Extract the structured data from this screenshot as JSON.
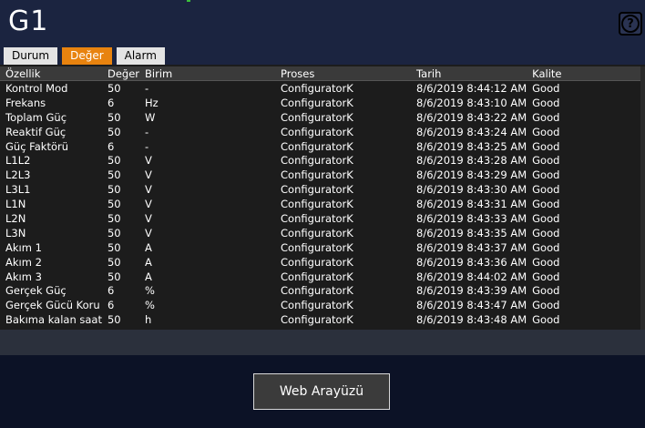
{
  "window": {
    "title": "G1"
  },
  "help": {
    "glyph": "?"
  },
  "tabs": [
    {
      "label": "Durum",
      "active": false
    },
    {
      "label": "Değer",
      "active": true
    },
    {
      "label": "Alarm",
      "active": false
    }
  ],
  "table": {
    "headers": [
      "Özellik",
      "Değer",
      "Birim",
      "Proses",
      "Tarih",
      "Kalite"
    ],
    "rows": [
      [
        "Kontrol Mod",
        "50",
        "-",
        "ConfiguratorK",
        "8/6/2019 8:44:12 AM",
        "Good"
      ],
      [
        "Frekans",
        "6",
        "Hz",
        "ConfiguratorK",
        "8/6/2019 8:43:10 AM",
        "Good"
      ],
      [
        "Toplam Güç",
        "50",
        "W",
        "ConfiguratorK",
        "8/6/2019 8:43:22 AM",
        "Good"
      ],
      [
        "Reaktif Güç",
        "50",
        "-",
        "ConfiguratorK",
        "8/6/2019 8:43:24 AM",
        "Good"
      ],
      [
        "Güç Faktörü",
        "6",
        "-",
        "ConfiguratorK",
        "8/6/2019 8:43:25 AM",
        "Good"
      ],
      [
        "L1L2",
        "50",
        "V",
        "ConfiguratorK",
        "8/6/2019 8:43:28 AM",
        "Good"
      ],
      [
        "L2L3",
        "50",
        "V",
        "ConfiguratorK",
        "8/6/2019 8:43:29 AM",
        "Good"
      ],
      [
        "L3L1",
        "50",
        "V",
        "ConfiguratorK",
        "8/6/2019 8:43:30 AM",
        "Good"
      ],
      [
        "L1N",
        "50",
        "V",
        "ConfiguratorK",
        "8/6/2019 8:43:31 AM",
        "Good"
      ],
      [
        "L2N",
        "50",
        "V",
        "ConfiguratorK",
        "8/6/2019 8:43:33 AM",
        "Good"
      ],
      [
        "L3N",
        "50",
        "V",
        "ConfiguratorK",
        "8/6/2019 8:43:35 AM",
        "Good"
      ],
      [
        "Akım 1",
        "50",
        "A",
        "ConfiguratorK",
        "8/6/2019 8:43:37 AM",
        "Good"
      ],
      [
        "Akım 2",
        "50",
        "A",
        "ConfiguratorK",
        "8/6/2019 8:43:36 AM",
        "Good"
      ],
      [
        "Akım 3",
        "50",
        "A",
        "ConfiguratorK",
        "8/6/2019 8:44:02 AM",
        "Good"
      ],
      [
        "Gerçek Güç",
        "6",
        "%",
        "ConfiguratorK",
        "8/6/2019 8:43:39 AM",
        "Good"
      ],
      [
        "Gerçek Gücü Koru",
        "6",
        "%",
        "ConfiguratorK",
        "8/6/2019 8:43:47 AM",
        "Good"
      ],
      [
        "Bakıma kalan saat",
        "50",
        "h",
        "ConfiguratorK",
        "8/6/2019 8:43:48 AM",
        "Good"
      ]
    ]
  },
  "web_button": {
    "label": "Web Arayüzü"
  },
  "colors": {
    "active_tab": "#e8830f",
    "background": "#1b2440"
  }
}
